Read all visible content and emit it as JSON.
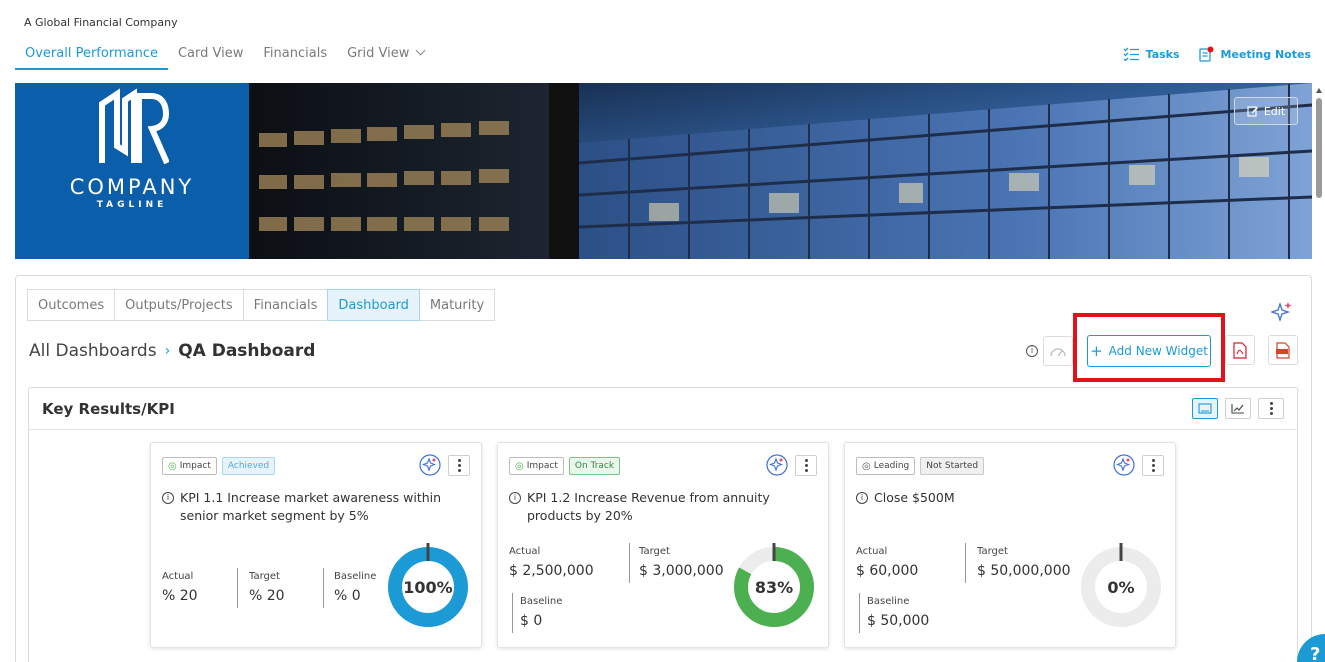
{
  "company": {
    "subtitle": "A Global Financial Company"
  },
  "nav": {
    "tabs": [
      "Overall Performance",
      "Card View",
      "Financials",
      "Grid View"
    ]
  },
  "toplinks": {
    "tasks": "Tasks",
    "meeting_notes": "Meeting Notes"
  },
  "banner": {
    "logo_name": "COMPANY",
    "logo_tagline": "TAGLINE",
    "edit_label": "Edit"
  },
  "subtabs": [
    "Outcomes",
    "Outputs/Projects",
    "Financials",
    "Dashboard",
    "Maturity"
  ],
  "breadcrumb": {
    "root": "All Dashboards",
    "current": "QA Dashboard"
  },
  "actions": {
    "add_widget_label": "Add New Widget"
  },
  "kpi_section": {
    "title": "Key Results/KPI"
  },
  "cards": [
    {
      "type_badge": "Impact",
      "status_badge": "Achieved",
      "title": "KPI 1.1 Increase market awareness within senior market segment by 5%",
      "actual_label": "Actual",
      "actual": "% 20",
      "target_label": "Target",
      "target": "% 20",
      "baseline_label": "Baseline",
      "baseline": "% 0",
      "percent_label": "100%",
      "percent": 100,
      "color": "#1b9ad6"
    },
    {
      "type_badge": "Impact",
      "status_badge": "On Track",
      "title": "KPI 1.2 Increase Revenue from annuity products by 20%",
      "actual_label": "Actual",
      "actual": "$ 2,500,000",
      "target_label": "Target",
      "target": "$ 3,000,000",
      "baseline_label": "Baseline",
      "baseline": "$ 0",
      "percent_label": "83%",
      "percent": 83,
      "color": "#4caf50"
    },
    {
      "type_badge": "Leading",
      "status_badge": "Not Started",
      "title": "Close $500M",
      "actual_label": "Actual",
      "actual": "$ 60,000",
      "target_label": "Target",
      "target": "$ 50,000,000",
      "baseline_label": "Baseline",
      "baseline": "$ 50,000",
      "percent_label": "0%",
      "percent": 0,
      "color": "#1b9ad6"
    }
  ],
  "colors": {
    "accent": "#1b9ad6",
    "highlight": "#e0131a",
    "logo_bg": "#0b5eaa",
    "track": "#ececec"
  }
}
